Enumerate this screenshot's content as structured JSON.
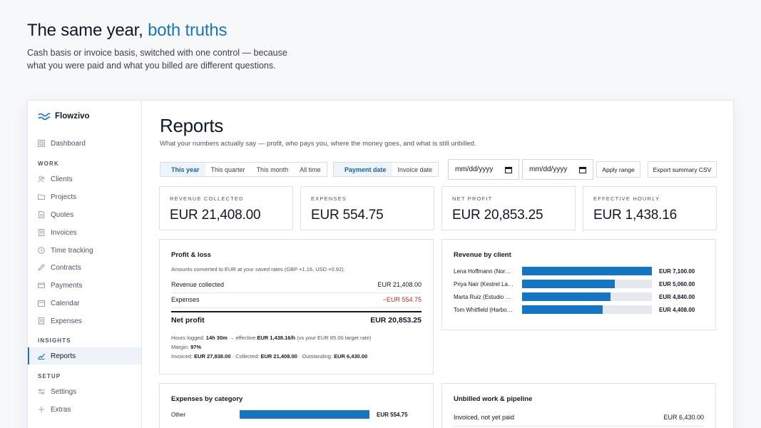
{
  "hero": {
    "title_main": "The same year, ",
    "title_accent": "both truths",
    "subtitle": "Cash basis or invoice basis, switched with one control — because what you were paid and what you billed are different questions."
  },
  "colors": {
    "accent": "#1b75bb",
    "bar": "#1675c2",
    "negative": "#b4321f"
  },
  "sidebar": {
    "brand": "Flowzivo",
    "dashboard": "Dashboard",
    "work_heading": "WORK",
    "work": [
      "Clients",
      "Projects",
      "Quotes",
      "Invoices",
      "Time tracking",
      "Contracts",
      "Payments",
      "Calendar",
      "Expenses"
    ],
    "insights_heading": "INSIGHTS",
    "reports": "Reports",
    "setup_heading": "SETUP",
    "settings": "Settings",
    "extras": "Extras"
  },
  "header": {
    "title": "Reports",
    "subtitle": "What your numbers actually say — profit, who pays you, where the money goes, and what is still unbilled."
  },
  "filters": {
    "periods": [
      "This year",
      "This quarter",
      "This month",
      "All time"
    ],
    "period_selected": "This year",
    "basis": [
      "Payment date",
      "Invoice date"
    ],
    "basis_selected": "Payment date",
    "date_from": "mm/dd/yyyy",
    "date_to": "mm/dd/yyyy",
    "apply": "Apply range",
    "export": "Export summary CSV"
  },
  "kpis": [
    {
      "label": "REVENUE COLLECTED",
      "value": "EUR 21,408.00"
    },
    {
      "label": "EXPENSES",
      "value": "EUR 554.75"
    },
    {
      "label": "NET PROFIT",
      "value": "EUR 20,853.25"
    },
    {
      "label": "EFFECTIVE HOURLY",
      "value": "EUR 1,438.16"
    }
  ],
  "pnl": {
    "title": "Profit & loss",
    "note": "Amounts converted to EUR at your saved rates (GBP ×1.16, USD ×0.92).",
    "revenue_label": "Revenue collected",
    "revenue_value": "EUR 21,408.00",
    "expenses_label": "Expenses",
    "expenses_value": "−EUR 554.75",
    "net_label": "Net profit",
    "net_value": "EUR 20,853.25",
    "hours_pre": "Hours logged: ",
    "hours": "14h 30m",
    "hours_mid": " → effective ",
    "effective": "EUR 1,438.16/h",
    "hours_post": " (vs your EUR 85.00 target rate)",
    "margin_pre": "Margin: ",
    "margin": "97%",
    "invoiced_pre": "Invoiced: ",
    "invoiced": "EUR 27,838.00",
    "collected_pre": " · Collected: ",
    "collected": "EUR 21,408.00",
    "outstanding_pre": " · Outstanding: ",
    "outstanding": "EUR 6,430.00"
  },
  "revenue_by_client": {
    "title": "Revenue by client",
    "max": 7100,
    "rows": [
      {
        "label": "Lena Hoffmann (Nor…",
        "amount": 7100,
        "value": "EUR 7,100.00"
      },
      {
        "label": "Priya Nair (Kestrel La…",
        "amount": 5060,
        "value": "EUR 5,060.00"
      },
      {
        "label": "Marta Ruiz (Estudio …",
        "amount": 4840,
        "value": "EUR 4,840.00"
      },
      {
        "label": "Tom Whitfield (Harbo…",
        "amount": 4408,
        "value": "EUR 4,408.00"
      }
    ]
  },
  "expenses_by_category": {
    "title": "Expenses by category",
    "max": 554.75,
    "rows": [
      {
        "label": "Other",
        "amount": 554.75,
        "value": "EUR 554.75"
      }
    ]
  },
  "unbilled": {
    "title": "Unbilled work & pipeline",
    "rows": [
      {
        "label": "Invoiced, not yet paid",
        "value": "EUR 6,430.00"
      }
    ]
  }
}
